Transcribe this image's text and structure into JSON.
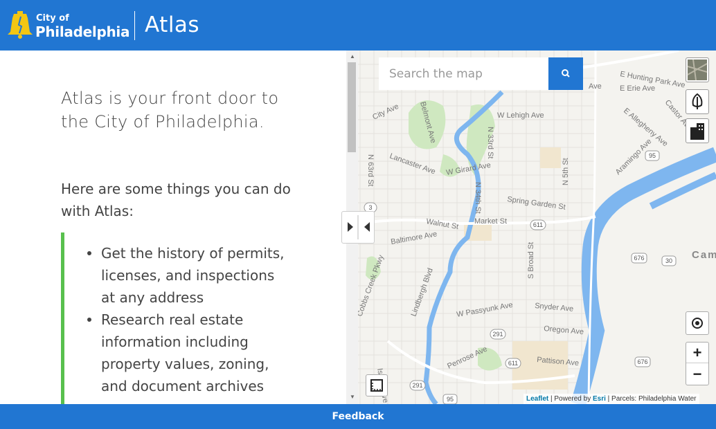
{
  "header": {
    "logo_small": "City of",
    "logo_big": "Philadelphia",
    "title": "Atlas"
  },
  "left_panel": {
    "intro": "Atlas is your front door to the City of Philadelphia.",
    "subheading": "Here are some things you can do with Atlas:",
    "items": [
      "Get the history of permits, licenses, and inspections at any address",
      "Research real estate information including property values, zoning, and document archives"
    ]
  },
  "map": {
    "search_placeholder": "Search the map",
    "zoom_in": "+",
    "zoom_out": "−",
    "attribution": {
      "leaflet": "Leaflet",
      "powered_by": " | Powered by ",
      "esri": "Esri",
      "parcels": " | Parcels: Philadelphia Water"
    },
    "labels": [
      "E Hunting Park Ave",
      "E Erie Ave",
      "Ave",
      "City Ave",
      "W Lehigh Ave",
      "E Allegheny Ave",
      "Castor Ave",
      "Belmont Ave",
      "N 33rd St",
      "Aramingo Ave",
      "Lancaster Ave",
      "W Girard Ave",
      "N 63rd St",
      "N 34th St",
      "Spring Garden St",
      "N 5th St",
      "Walnut St",
      "Market St",
      "Baltimore Ave",
      "S Broad St",
      "Cam",
      "Lindbergh Blvd",
      "W Passyunk Ave",
      "Snyder Ave",
      "Oregon Ave",
      "Penrose Ave",
      "Pattison Ave",
      "Island Ave",
      "Cobbs Creek Pkwy"
    ],
    "shields": [
      "95",
      "3",
      "611",
      "676",
      "30",
      "291",
      "611",
      "291",
      "95",
      "676"
    ]
  },
  "footer": {
    "feedback": "Feedback"
  },
  "colors": {
    "brand_blue": "#2176d2",
    "callout_green": "#58c04d",
    "water": "#7eb6ef",
    "park": "#cfe8c0"
  }
}
